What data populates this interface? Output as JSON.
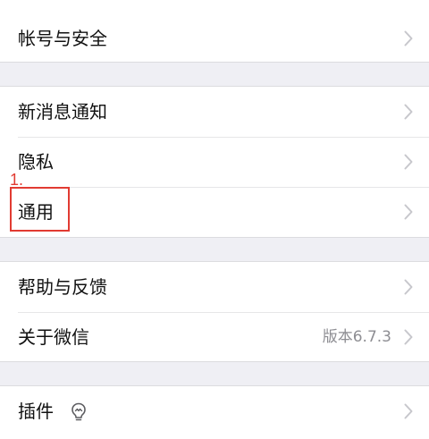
{
  "groups": {
    "account": {
      "items": [
        {
          "label": "帐号与安全"
        }
      ]
    },
    "notifications": {
      "items": [
        {
          "label": "新消息通知"
        },
        {
          "label": "隐私"
        },
        {
          "label": "通用"
        }
      ]
    },
    "about": {
      "items": [
        {
          "label": "帮助与反馈"
        },
        {
          "label": "关于微信",
          "value": "版本6.7.3"
        }
      ]
    },
    "plugins": {
      "items": [
        {
          "label": "插件",
          "icon": "lightbulb-icon"
        }
      ]
    }
  },
  "annotation": {
    "number": "1.",
    "color": "#e13b32"
  },
  "colors": {
    "background": "#efeff4",
    "cell": "#ffffff",
    "text": "#111111",
    "secondary": "#8e8e93",
    "chevron": "#c7c7cc"
  }
}
